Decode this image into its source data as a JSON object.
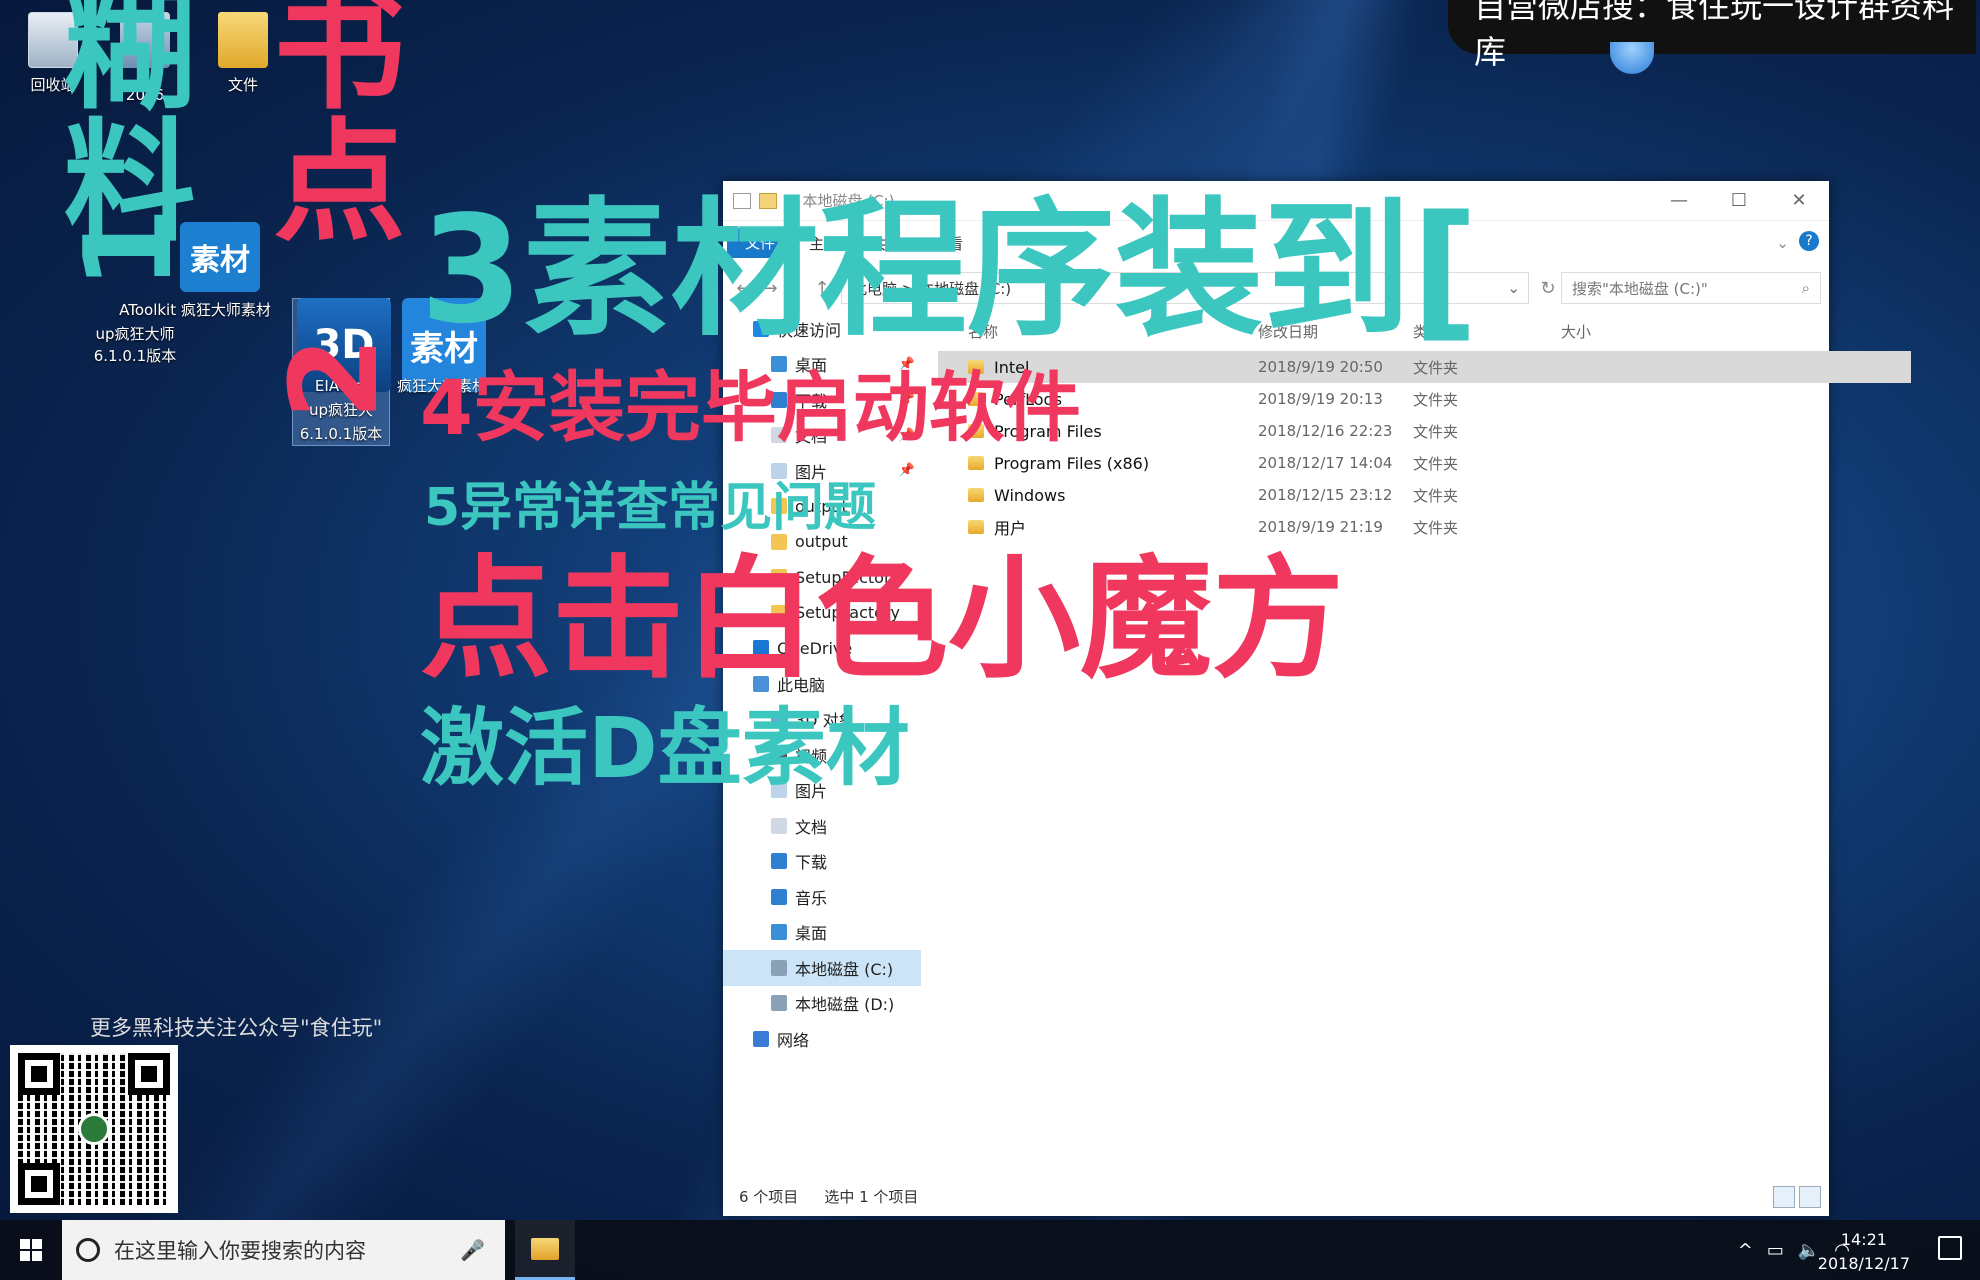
{
  "desktop": {
    "icons": [
      {
        "label": "回收站"
      },
      {
        "label": "2016"
      },
      {
        "label": "文件"
      }
    ],
    "app_tiles": [
      {
        "label": "素材"
      },
      {
        "label": "3D"
      },
      {
        "label": "素材"
      }
    ],
    "app_labels": [
      {
        "label": "AToolkit 疯狂大师素材"
      },
      {
        "label": "up疯狂大师"
      },
      {
        "label": "6.1.0.1版本"
      },
      {
        "label": "EIATool"
      },
      {
        "label": "up疯狂大"
      },
      {
        "label": "6.1.0.1版本"
      },
      {
        "label": "疯狂大师素材"
      }
    ]
  },
  "banner": {
    "text": "自营微店搜：食住玩一设计群资料库"
  },
  "overlay": {
    "big_1": "1",
    "big_1b": "糊",
    "big_1c": "料",
    "big_2": "2",
    "big_2b": "书",
    "big_2c": "点",
    "line3": "3素材程序装到[",
    "line4": "4安装完毕启动软件",
    "line5": "5异常详查常见问题",
    "line6": "点击白色小魔方",
    "line7": "激活D盘素材"
  },
  "explorer": {
    "title": "本地磁盘 (C:)",
    "controls": {
      "min": "—",
      "max": "☐",
      "close": "✕"
    },
    "ribbon": {
      "file": "文件",
      "tabs": [
        "主页",
        "共享",
        "查看"
      ],
      "help": "?"
    },
    "address": {
      "path": "此电脑 > 本地磁盘 (C:)",
      "search_placeholder": "搜索\"本地磁盘 (C:)\""
    },
    "nav": [
      {
        "label": "快速访问",
        "icon": "star-icon",
        "top": true
      },
      {
        "label": "桌面",
        "icon": "desktop-icon",
        "pinned": true
      },
      {
        "label": "下载",
        "icon": "download-icon",
        "pinned": true
      },
      {
        "label": "文档",
        "icon": "document-icon",
        "pinned": true
      },
      {
        "label": "图片",
        "icon": "picture-icon",
        "pinned": true
      },
      {
        "label": "output",
        "icon": "folder-icon"
      },
      {
        "label": "output",
        "icon": "folder-icon"
      },
      {
        "label": "SetupFactory",
        "icon": "folder-icon"
      },
      {
        "label": "SetupFactory",
        "icon": "folder-icon"
      },
      {
        "label": "OneDrive",
        "icon": "cloud-icon",
        "top": true
      },
      {
        "label": "此电脑",
        "icon": "computer-icon",
        "top": true
      },
      {
        "label": "3D 对象",
        "icon": "cube-icon"
      },
      {
        "label": "视频",
        "icon": "video-icon"
      },
      {
        "label": "图片",
        "icon": "picture-icon"
      },
      {
        "label": "文档",
        "icon": "document-icon"
      },
      {
        "label": "下载",
        "icon": "download-icon"
      },
      {
        "label": "音乐",
        "icon": "music-icon"
      },
      {
        "label": "桌面",
        "icon": "desktop-icon"
      },
      {
        "label": "本地磁盘 (C:)",
        "icon": "drive-icon",
        "selected": true
      },
      {
        "label": "本地磁盘 (D:)",
        "icon": "drive-icon"
      },
      {
        "label": "网络",
        "icon": "network-icon",
        "top": true
      }
    ],
    "columns": [
      "名称",
      "修改日期",
      "类型",
      "大小"
    ],
    "files": [
      {
        "name": "Intel",
        "date": "2018/9/19 20:50",
        "type": "文件夹",
        "selected": true
      },
      {
        "name": "PerfLogs",
        "date": "2018/9/19 20:13",
        "type": "文件夹"
      },
      {
        "name": "Program Files",
        "date": "2018/12/16 22:23",
        "type": "文件夹"
      },
      {
        "name": "Program Files (x86)",
        "date": "2018/12/17 14:04",
        "type": "文件夹"
      },
      {
        "name": "Windows",
        "date": "2018/12/15 23:12",
        "type": "文件夹"
      },
      {
        "name": "用户",
        "date": "2018/9/19 21:19",
        "type": "文件夹"
      }
    ],
    "status": {
      "count": "6 个项目",
      "selected": "选中 1 个项目"
    }
  },
  "qr": {
    "caption": "更多黑科技关注公众号\"食住玩\""
  },
  "taskbar": {
    "search_placeholder": "在这里输入你要搜索的内容",
    "time": "14:21",
    "date": "2018/12/17"
  },
  "colors": {
    "teal": "#3cc6c0",
    "red": "#f0385e",
    "accent": "#1979ca"
  }
}
